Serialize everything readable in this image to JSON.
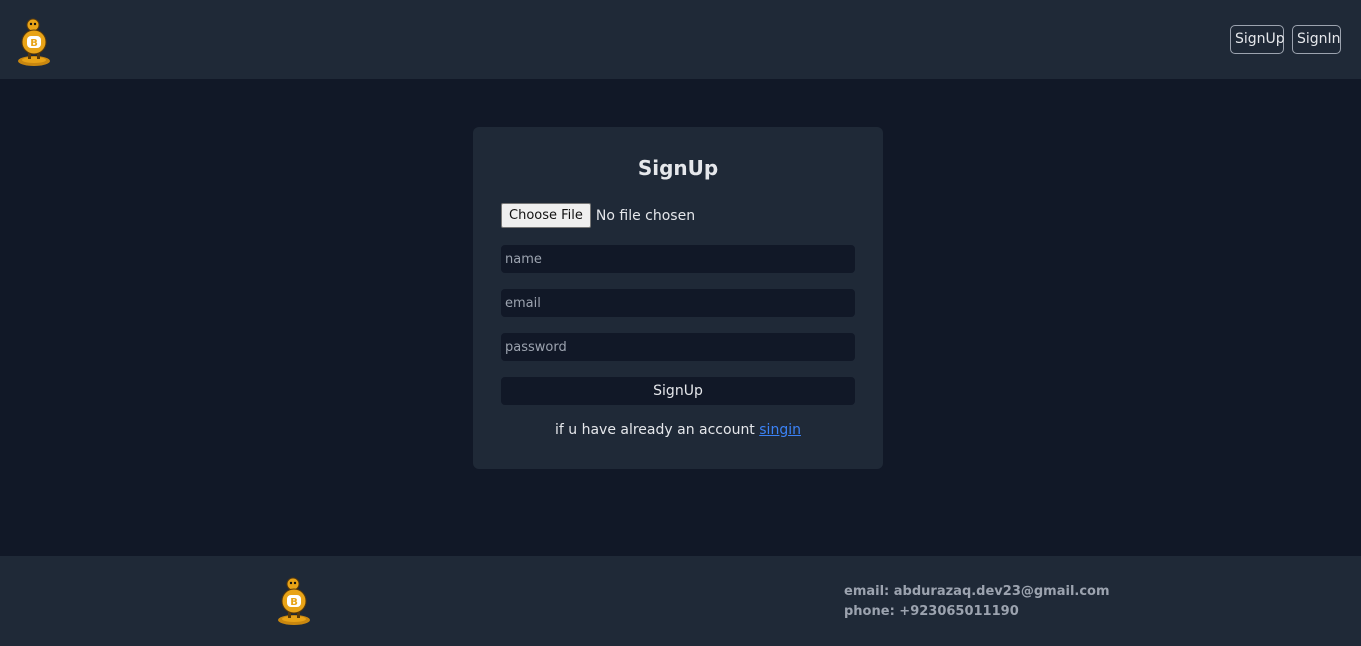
{
  "header": {
    "nav": {
      "signup_label": "SignUp",
      "signin_label": "SignIn"
    }
  },
  "form": {
    "title": "SignUp",
    "file": {
      "button_label": "Choose File",
      "status": "No file chosen"
    },
    "fields": {
      "name_placeholder": "name",
      "email_placeholder": "email",
      "password_placeholder": "password"
    },
    "submit_label": "SignUp",
    "switch_text": "if u have already an account",
    "switch_link": "singin"
  },
  "footer": {
    "email_label": "email:",
    "email": "abdurazaq.dev23@gmail.com",
    "phone_label": "phone:",
    "phone": "+923065011190"
  },
  "colors": {
    "page_bg": "#111827",
    "panel_bg": "#1f2937",
    "link": "#3b82f6",
    "logo_orange": "#e8a317"
  }
}
